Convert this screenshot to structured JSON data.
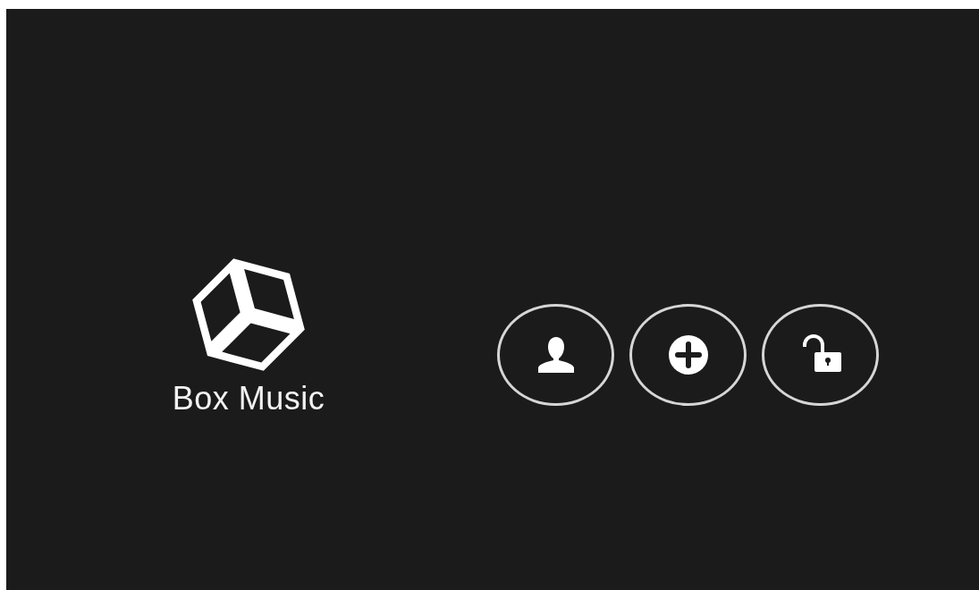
{
  "logo": {
    "title": "Box Music"
  },
  "buttons": [
    {
      "kind": "user"
    },
    {
      "kind": "add"
    },
    {
      "kind": "unlock"
    }
  ]
}
